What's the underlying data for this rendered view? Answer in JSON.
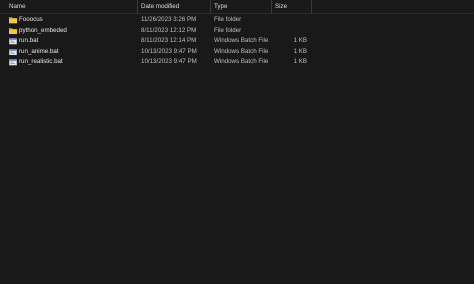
{
  "columns": {
    "name": "Name",
    "date": "Date modified",
    "type": "Type",
    "size": "Size",
    "sort_indicator": "^"
  },
  "files": [
    {
      "name": "Fooocus",
      "date": "11/26/2023 3:26 PM",
      "type": "File folder",
      "size": "",
      "icon": "folder-icon"
    },
    {
      "name": "python_embeded",
      "date": "8/11/2023 12:12 PM",
      "type": "File folder",
      "size": "",
      "icon": "folder-icon"
    },
    {
      "name": "run.bat",
      "date": "8/11/2023 12:14 PM",
      "type": "Windows Batch File",
      "size": "1 KB",
      "icon": "batch-file-icon"
    },
    {
      "name": "run_anime.bat",
      "date": "10/13/2023 9:47 PM",
      "type": "Windows Batch File",
      "size": "1 KB",
      "icon": "batch-file-icon"
    },
    {
      "name": "run_realistic.bat",
      "date": "10/13/2023 9:47 PM",
      "type": "Windows Batch File",
      "size": "1 KB",
      "icon": "batch-file-icon"
    }
  ],
  "colors": {
    "background": "#191919",
    "folder": "#e8c048",
    "text": "#d6d6d6"
  }
}
